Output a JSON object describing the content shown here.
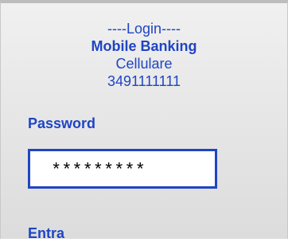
{
  "login": {
    "heading": "----Login----",
    "bank_name": "Mobile Banking",
    "phone_label": "Cellulare",
    "phone_number": "3491111111"
  },
  "password": {
    "label": "Password",
    "value": "*********"
  },
  "actions": {
    "enter_label": "Entra"
  },
  "colors": {
    "accent": "#1f45c4",
    "background_top": "#f0f0f0",
    "background_bottom": "#dcdcdc",
    "field_background": "#ffffff"
  }
}
